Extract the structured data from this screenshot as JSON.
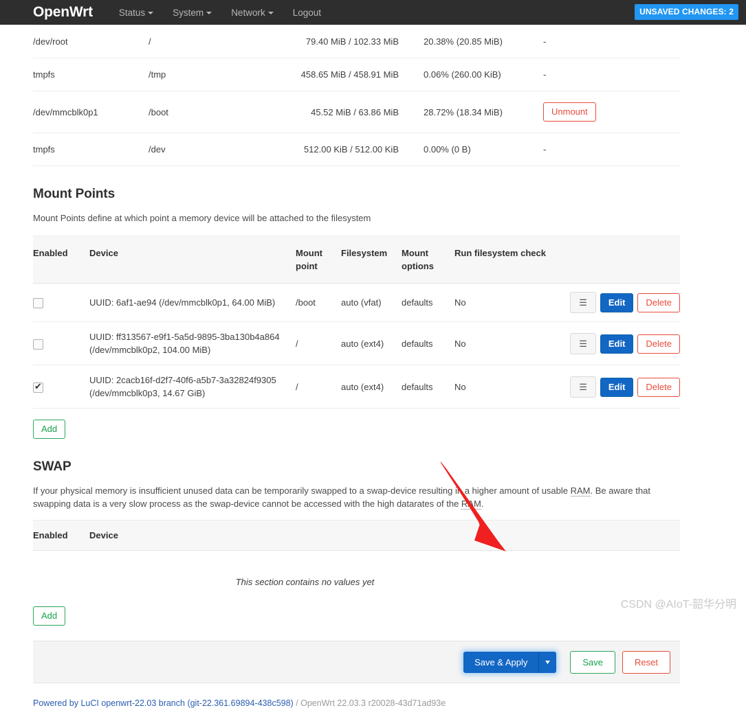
{
  "nav": {
    "brand": "OpenWrt",
    "items": [
      {
        "label": "Status",
        "caret": true
      },
      {
        "label": "System",
        "caret": true
      },
      {
        "label": "Network",
        "caret": true
      },
      {
        "label": "Logout",
        "caret": false
      }
    ],
    "unsaved_badge": "UNSAVED CHANGES: 2",
    "badge_color": "#2196f3"
  },
  "mounted_filesystems": {
    "rows": [
      {
        "device": "/dev/root",
        "mount_point": "/",
        "available": "79.40 MiB / 102.33 MiB",
        "used": "20.38% (20.85 MiB)",
        "action": "-",
        "has_button": false
      },
      {
        "device": "tmpfs",
        "mount_point": "/tmp",
        "available": "458.65 MiB / 458.91 MiB",
        "used": "0.06% (260.00 KiB)",
        "action": "-",
        "has_button": false
      },
      {
        "device": "/dev/mmcblk0p1",
        "mount_point": "/boot",
        "available": "45.52 MiB / 63.86 MiB",
        "used": "28.72% (18.34 MiB)",
        "action": "Unmount",
        "has_button": true
      },
      {
        "device": "tmpfs",
        "mount_point": "/dev",
        "available": "512.00 KiB / 512.00 KiB",
        "used": "0.00% (0 B)",
        "action": "-",
        "has_button": false
      }
    ]
  },
  "mount_points": {
    "title": "Mount Points",
    "description": "Mount Points define at which point a memory device will be attached to the filesystem",
    "columns": {
      "enabled": "Enabled",
      "device": "Device",
      "mount_point": "Mount point",
      "filesystem": "Filesystem",
      "mount_options": "Mount options",
      "check": "Run filesystem check"
    },
    "rows": [
      {
        "enabled": false,
        "device": "UUID: 6af1-ae94 (/dev/mmcblk0p1, 64.00 MiB)",
        "device_line2": "",
        "mount_point": "/boot",
        "filesystem": "auto (vfat)",
        "mount_options": "defaults",
        "check": "No",
        "menu_icon": "hamburger-icon",
        "edit_label": "Edit",
        "delete_label": "Delete"
      },
      {
        "enabled": false,
        "device": "UUID: ff313567-e9f1-5a5d-9895-3ba130b4a864",
        "device_line2": "(/dev/mmcblk0p2, 104.00 MiB)",
        "mount_point": "/",
        "filesystem": "auto (ext4)",
        "mount_options": "defaults",
        "check": "No",
        "menu_icon": "hamburger-icon",
        "edit_label": "Edit",
        "delete_label": "Delete"
      },
      {
        "enabled": true,
        "device": "UUID: 2cacb16f-d2f7-40f6-a5b7-3a32824f9305",
        "device_line2": "(/dev/mmcblk0p3, 14.67 GiB)",
        "mount_point": "/",
        "filesystem": "auto (ext4)",
        "mount_options": "defaults",
        "check": "No",
        "menu_icon": "hamburger-icon",
        "edit_label": "Edit",
        "delete_label": "Delete"
      }
    ],
    "add_label": "Add"
  },
  "swap": {
    "title": "SWAP",
    "description_part1": "If your physical memory is insufficient unused data can be temporarily swapped to a swap-device resulting in a higher amount of usable ",
    "abbr1": "RAM",
    "description_part2": ". Be aware that swapping data is a very slow process as the swap-device cannot be accessed with the high datarates of the ",
    "abbr2": "RAM",
    "description_part3": ".",
    "columns": {
      "enabled": "Enabled",
      "device": "Device"
    },
    "empty_text": "This section contains no values yet",
    "add_label": "Add"
  },
  "actions": {
    "save_apply_label": "Save & Apply",
    "dropdown_icon": "chevron-down-icon",
    "save_label": "Save",
    "reset_label": "Reset",
    "primary_color": "#1266c4",
    "save_color": "#16a34a",
    "reset_color": "#e74c3c"
  },
  "footer": {
    "link_text": "Powered by LuCI openwrt-22.03 branch (git-22.361.69894-438c598)",
    "suffix": " / OpenWrt 22.03.3 r20028-43d71ad93e"
  },
  "watermark": "CSDN @AIoT-韶华分明",
  "annotation": {
    "type": "arrow",
    "color": "#f02020"
  }
}
